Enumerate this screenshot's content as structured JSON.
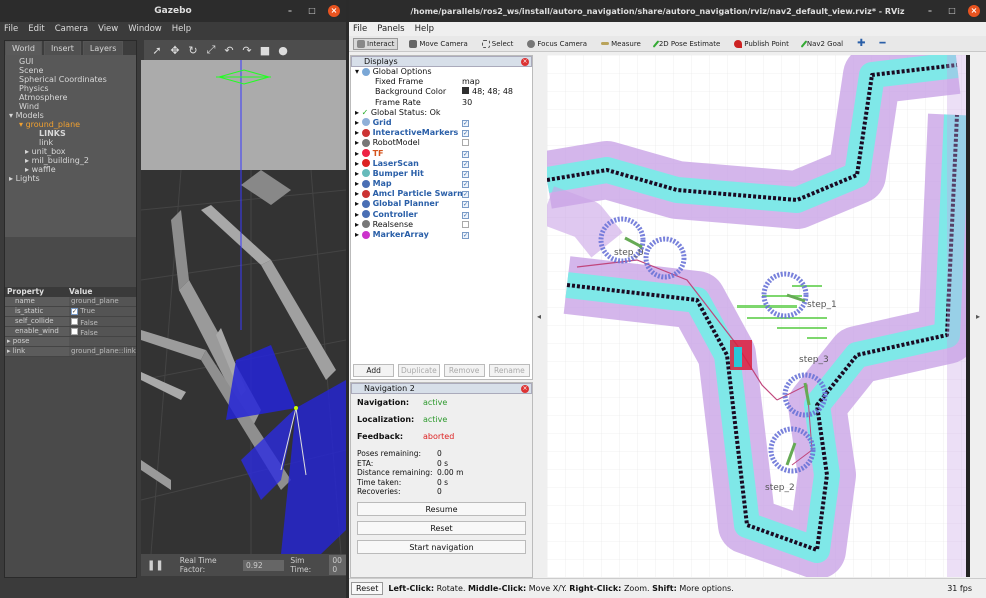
{
  "gazebo": {
    "title": "Gazebo",
    "menu": [
      "File",
      "Edit",
      "Camera",
      "View",
      "Window",
      "Help"
    ],
    "tabs": [
      "World",
      "Insert",
      "Layers"
    ],
    "tree": [
      "GUI",
      "Scene",
      "Spherical Coordinates",
      "Physics",
      "Atmosphere",
      "Wind",
      "Models",
      "ground_plane",
      "LINKS",
      "link",
      "unit_box",
      "mil_building_2",
      "waffle",
      "Lights"
    ],
    "prop_headers": [
      "Property",
      "Value"
    ],
    "props": [
      {
        "k": "name",
        "v": "ground_plane"
      },
      {
        "k": "is_static",
        "v": "True"
      },
      {
        "k": "self_collide",
        "v": "False"
      },
      {
        "k": "enable_wind",
        "v": "False"
      },
      {
        "k": "pose",
        "v": ""
      },
      {
        "k": "link",
        "v": "ground_plane::link"
      }
    ],
    "status": {
      "rtf_label": "Real Time Factor:",
      "rtf": "0.92",
      "sim_label": "Sim Time:",
      "sim": "00 0"
    }
  },
  "rviz": {
    "title": "/home/parallels/ros2_ws/install/autoro_navigation/share/autoro_navigation/rviz/nav2_default_view.rviz* - RViz",
    "menu": [
      "File",
      "Panels",
      "Help"
    ],
    "tools": [
      "Interact",
      "Move Camera",
      "Select",
      "Focus Camera",
      "Measure",
      "2D Pose Estimate",
      "Publish Point",
      "Nav2 Goal"
    ],
    "displays_title": "Displays",
    "global_options": "Global Options",
    "options": [
      {
        "k": "Fixed Frame",
        "v": "map"
      },
      {
        "k": "Background Color",
        "v": "48; 48; 48"
      },
      {
        "k": "Frame Rate",
        "v": "30"
      }
    ],
    "global_status": "Global Status: Ok",
    "displays": [
      {
        "name": "Grid",
        "style": "blue",
        "checked": true,
        "color": "#8fb0d8"
      },
      {
        "name": "InteractiveMarkers",
        "style": "blue",
        "checked": true,
        "color": "#c33"
      },
      {
        "name": "RobotModel",
        "style": "plain",
        "checked": false,
        "color": "#777"
      },
      {
        "name": "TF",
        "style": "orange",
        "checked": true,
        "color": "#e24"
      },
      {
        "name": "LaserScan",
        "style": "blue",
        "checked": true,
        "color": "#d22"
      },
      {
        "name": "Bumper Hit",
        "style": "blue",
        "checked": true,
        "color": "#6bb"
      },
      {
        "name": "Map",
        "style": "blue",
        "checked": true,
        "color": "#4a6fb5"
      },
      {
        "name": "Amcl Particle Swarm",
        "style": "blue",
        "checked": true,
        "color": "#c33"
      },
      {
        "name": "Global Planner",
        "style": "blue",
        "checked": true,
        "color": "#4a6fb5"
      },
      {
        "name": "Controller",
        "style": "blue",
        "checked": true,
        "color": "#4a6fb5"
      },
      {
        "name": "Realsense",
        "style": "plain",
        "checked": false,
        "color": "#777"
      },
      {
        "name": "MarkerArray",
        "style": "blue",
        "checked": true,
        "color": "#c3c"
      }
    ],
    "disp_buttons": [
      "Add",
      "Duplicate",
      "Remove",
      "Rename"
    ],
    "nav2_title": "Navigation 2",
    "nav2": {
      "navigation_label": "Navigation:",
      "navigation": "active",
      "localization_label": "Localization:",
      "localization": "active",
      "feedback_label": "Feedback:",
      "feedback": "aborted"
    },
    "stats": [
      {
        "k": "Poses remaining:",
        "v": "0"
      },
      {
        "k": "ETA:",
        "v": "0 s"
      },
      {
        "k": "Distance remaining:",
        "v": "0.00 m"
      },
      {
        "k": "Time taken:",
        "v": "0 s"
      },
      {
        "k": "Recoveries:",
        "v": "0"
      }
    ],
    "nav2_buttons": [
      "Resume",
      "Reset",
      "Start navigation"
    ],
    "map_labels": [
      "step_0",
      "step_1",
      "step_2",
      "step_3"
    ],
    "status": {
      "reset": "Reset",
      "left": "Left-Click:",
      "left_v": "Rotate.",
      "middle": "Middle-Click:",
      "middle_v": "Move X/Y.",
      "right": "Right-Click:",
      "right_v": "Zoom.",
      "shift": "Shift:",
      "shift_v": "More options.",
      "fps": "31 fps"
    }
  }
}
